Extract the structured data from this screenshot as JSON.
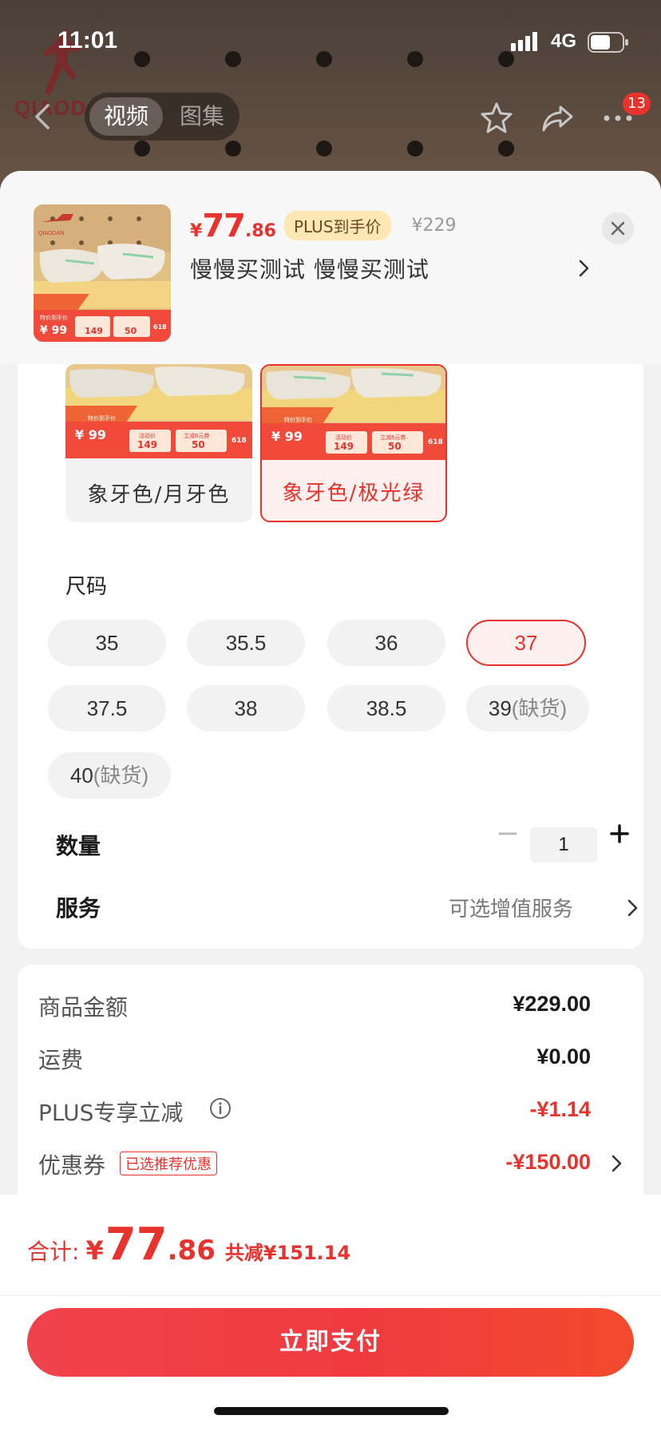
{
  "status_bar": {
    "time": "11:01",
    "network": "4G"
  },
  "background": {
    "brand": "QIAOD"
  },
  "nav": {
    "tabs": [
      {
        "label": "视频",
        "active": true
      },
      {
        "label": "图集",
        "active": false
      }
    ],
    "message_count": "13"
  },
  "product": {
    "currency": "¥",
    "price_int": "77",
    "price_dec": ".86",
    "plus_badge": "PLUS到手价",
    "original_price": "¥229",
    "spec_text": "慢慢买测试  慢慢买测试"
  },
  "color_options": [
    {
      "label": "象牙色/月牙色",
      "selected": false
    },
    {
      "label": "象牙色/极光绿",
      "selected": true
    }
  ],
  "size_section": {
    "title": "尺码",
    "sizes": [
      {
        "value": "35",
        "note": "",
        "selected": false
      },
      {
        "value": "35.5",
        "note": "",
        "selected": false
      },
      {
        "value": "36",
        "note": "",
        "selected": false
      },
      {
        "value": "37",
        "note": "",
        "selected": true
      },
      {
        "value": "37.5",
        "note": "",
        "selected": false
      },
      {
        "value": "38",
        "note": "",
        "selected": false
      },
      {
        "value": "38.5",
        "note": "",
        "selected": false
      },
      {
        "value": "39",
        "note": "(缺货)",
        "selected": false
      },
      {
        "value": "40",
        "note": "(缺货)",
        "selected": false
      }
    ]
  },
  "quantity": {
    "label": "数量",
    "value": "1"
  },
  "service": {
    "label": "服务",
    "value": "可选增值服务"
  },
  "price_breakdown": {
    "rows": [
      {
        "label": "商品金额",
        "value": "¥229.00"
      },
      {
        "label": "运费",
        "value": "¥0.00"
      },
      {
        "label": "PLUS专享立减",
        "value": "-¥1.14"
      },
      {
        "label": "优惠券",
        "value": "-¥150.00"
      }
    ],
    "coupon_tag": "已选推荐优惠"
  },
  "footer": {
    "total_label": "合计:",
    "currency": "¥",
    "total_int": "77",
    "total_dec": ".86",
    "saved": "共减¥151.14",
    "pay_button": "立即支付"
  },
  "colors": {
    "accent": "#e8322d",
    "plus_badge_bg": "#fde7b3",
    "pay_button_start": "#f0424b",
    "pay_button_end": "#f24a2c"
  }
}
